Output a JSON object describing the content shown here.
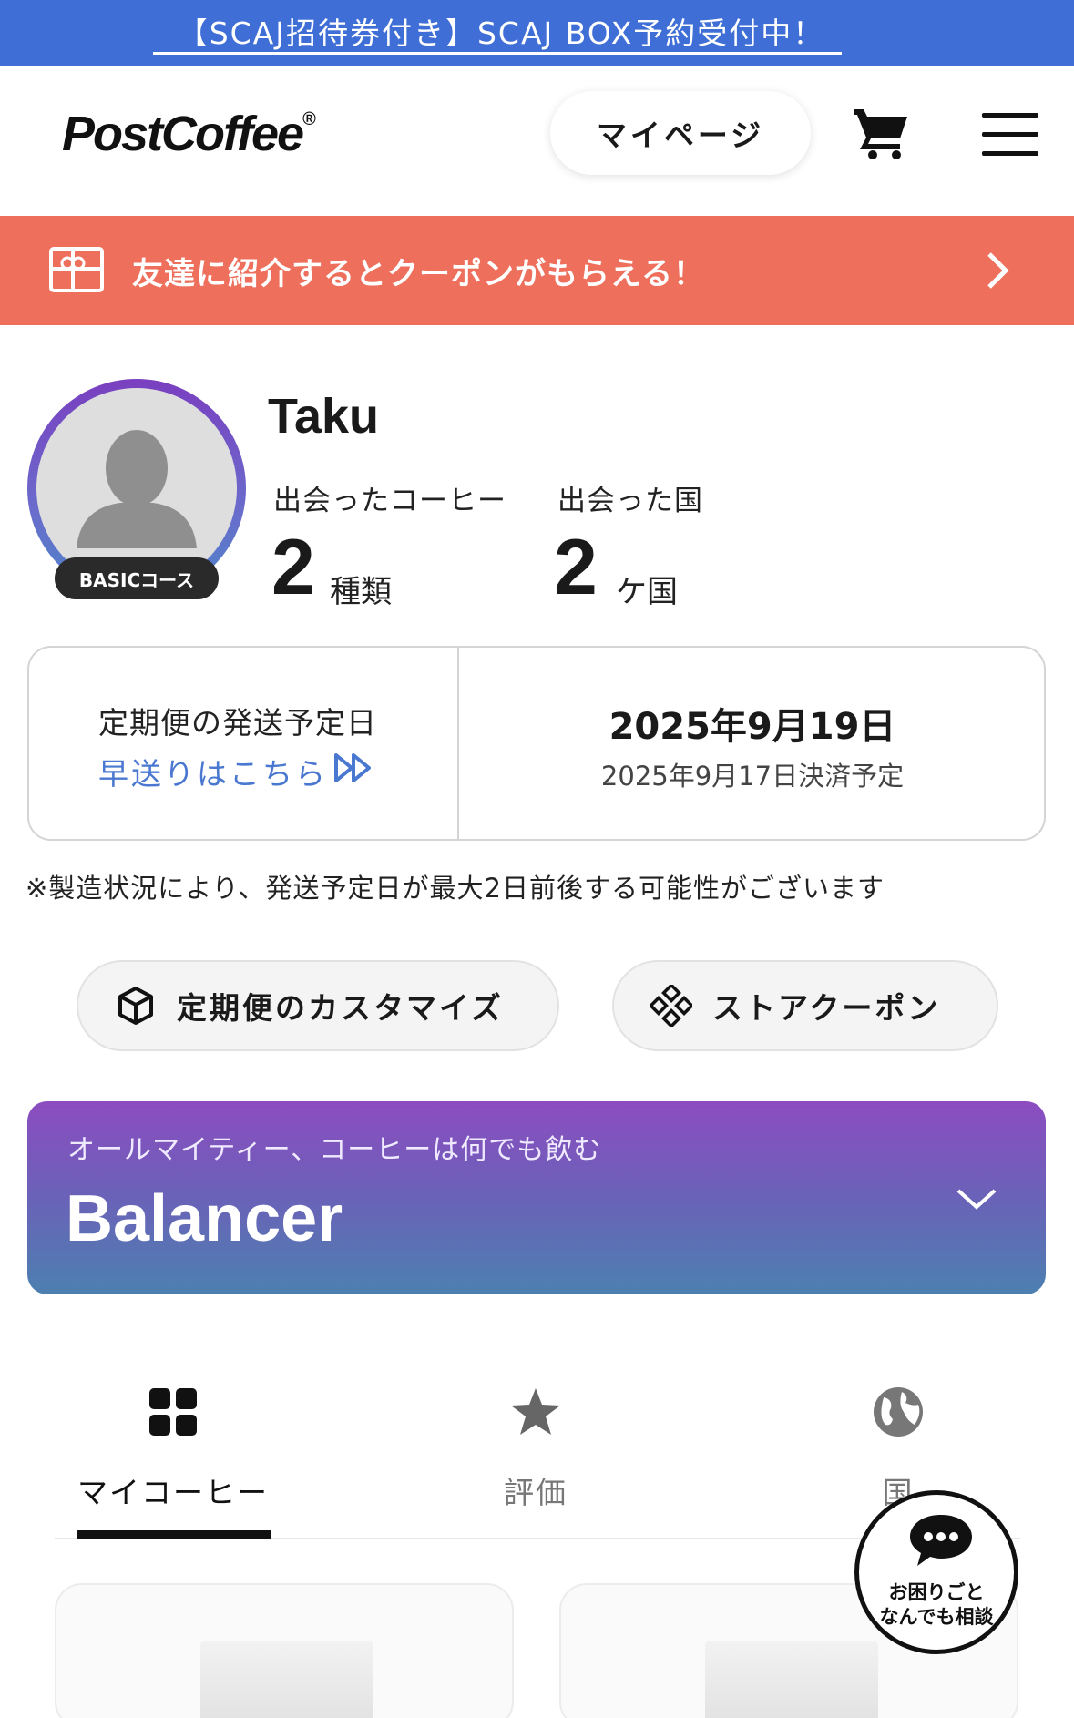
{
  "top_banner": {
    "text": "【SCAJ招待券付き】SCAJ BOX予約受付中！"
  },
  "header": {
    "logo": "PostCoffee",
    "logo_mark": "®",
    "mypage_label": "マイページ",
    "cart_icon": "cart-icon",
    "menu_icon": "hamburger-menu-icon"
  },
  "referral": {
    "text": "友達に紹介するとクーポンがもらえる！",
    "icon": "gift-icon",
    "bg_color": "#ee6f5c"
  },
  "profile": {
    "name": "Taku",
    "course_badge": "BASICコース",
    "coffee_label": "出会ったコーヒー",
    "coffee_count": "2",
    "coffee_unit": "種類",
    "country_label": "出会った国",
    "country_count": "2",
    "country_unit": "ケ国"
  },
  "shipping": {
    "label": "定期便の発送予定日",
    "fast_link": "早送りはこちら",
    "date": "2025年9月19日",
    "payment": "2025年9月17日決済予定",
    "note": "※製造状況により、発送予定日が最大2日前後する可能性がございます",
    "link_color": "#4a78d0"
  },
  "actions": {
    "customize_label": "定期便のカスタマイズ",
    "coupon_label": "ストアクーポン"
  },
  "coffee_type": {
    "subtitle": "オールマイティー、コーヒーは何でも飲む",
    "name": "Balancer"
  },
  "tabs": [
    {
      "label": "マイコーヒー",
      "icon": "grid-icon",
      "active": true
    },
    {
      "label": "評価",
      "icon": "star-icon",
      "active": false
    },
    {
      "label": "国",
      "icon": "globe-icon",
      "active": false
    }
  ],
  "chat": {
    "line1": "お困りごと",
    "line2": "なんでも相談",
    "icon": "chat-bubble-icon"
  }
}
